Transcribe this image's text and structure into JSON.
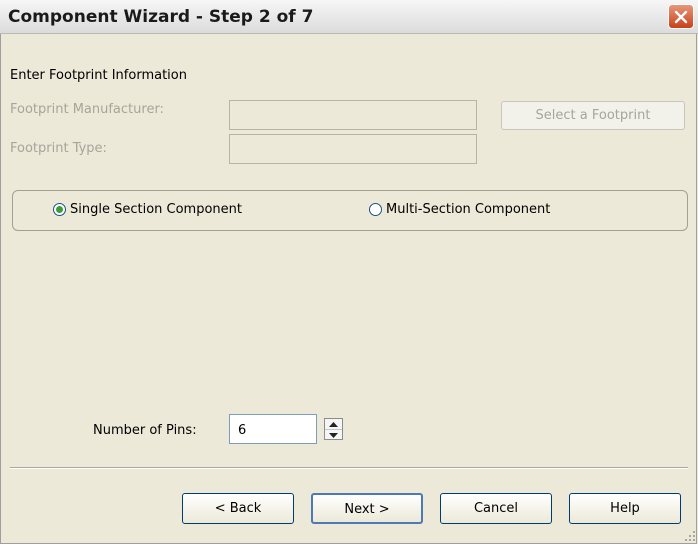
{
  "window": {
    "title": "Component Wizard - Step 2 of 7",
    "close_icon": "close-icon"
  },
  "section_heading": "Enter Footprint Information",
  "footprint": {
    "manufacturer_label": "Footprint Manufacturer:",
    "manufacturer_value": "",
    "type_label": "Footprint Type:",
    "type_value": "",
    "select_button": "Select a Footprint"
  },
  "component_type": {
    "options": [
      "Single Section Component",
      "Multi-Section Component"
    ],
    "selected": "Single Section Component"
  },
  "pins": {
    "label": "Number of Pins:",
    "value": "6"
  },
  "buttons": {
    "back": "< Back",
    "next": "Next >",
    "cancel": "Cancel",
    "help": "Help"
  }
}
